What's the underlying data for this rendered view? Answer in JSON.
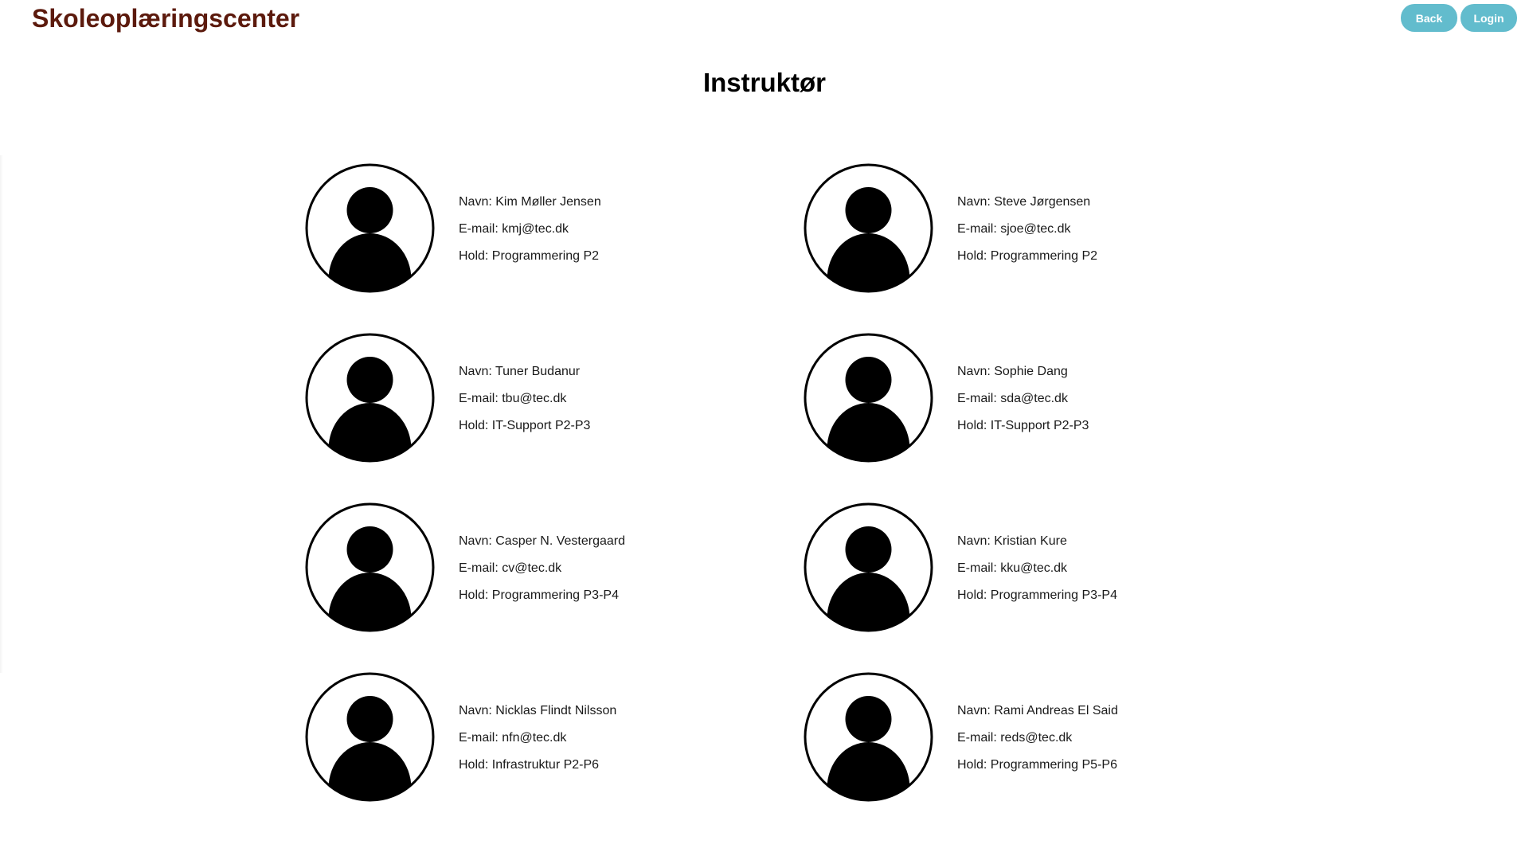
{
  "header": {
    "site_title": "Skoleoplæringscenter",
    "back_label": "Back",
    "login_label": "Login"
  },
  "main": {
    "heading": "Instruktør",
    "instructors": [
      {
        "name": "Navn: Kim Møller Jensen",
        "email": "E-mail: kmj@tec.dk",
        "team": "Hold: Programmering P2"
      },
      {
        "name": "Navn: Steve Jørgensen",
        "email": "E-mail: sjoe@tec.dk",
        "team": "Hold: Programmering P2"
      },
      {
        "name": "Navn: Tuner Budanur",
        "email": "E-mail: tbu@tec.dk",
        "team": "Hold: IT-Support P2-P3"
      },
      {
        "name": "Navn: Sophie Dang",
        "email": "E-mail: sda@tec.dk",
        "team": "Hold: IT-Support P2-P3"
      },
      {
        "name": "Navn: Casper N. Vestergaard",
        "email": "E-mail: cv@tec.dk",
        "team": "Hold: Programmering P3-P4"
      },
      {
        "name": "Navn: Kristian Kure",
        "email": "E-mail: kku@tec.dk",
        "team": "Hold: Programmering P3-P4"
      },
      {
        "name": "Navn: Nicklas Flindt Nilsson",
        "email": "E-mail: nfn@tec.dk",
        "team": "Hold: Infrastruktur P2-P6"
      },
      {
        "name": "Navn: Rami Andreas El Said",
        "email": "E-mail: reds@tec.dk",
        "team": "Hold: Programmering P5-P6"
      }
    ]
  },
  "icons": {
    "avatar": "user-avatar-icon"
  },
  "colors": {
    "brand_title": "#5c1a0d",
    "button_bg": "#62bccd",
    "button_text": "#ffffff"
  }
}
